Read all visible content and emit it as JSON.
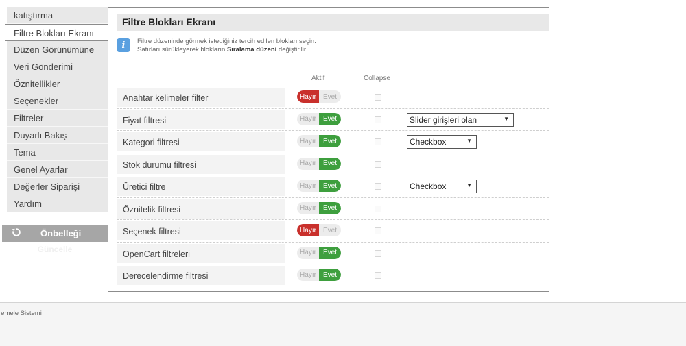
{
  "sidebar": {
    "items": [
      {
        "label": "katıştırma"
      },
      {
        "label": "Filtre Blokları Ekranı",
        "active": true
      },
      {
        "label": "Düzen Görünümüne"
      },
      {
        "label": "Veri Gönderimi"
      },
      {
        "label": "Öznitellikler"
      },
      {
        "label": "Seçenekler"
      },
      {
        "label": "Filtreler"
      },
      {
        "label": "Duyarlı Bakış"
      },
      {
        "label": "Tema"
      },
      {
        "label": "Genel Ayarlar"
      },
      {
        "label": "Değerler Siparişi"
      },
      {
        "label": "Yardım"
      }
    ],
    "cache_button": {
      "icon": "refresh-icon",
      "label": "Önbelleği",
      "sub_label": "Güncelle"
    }
  },
  "panel": {
    "title": "Filtre Blokları Ekranı",
    "info": {
      "icon": "info-icon",
      "line1": "Filtre düzeninde görmek istediğiniz tercih edilen blokları seçin.",
      "line2_prefix": "Satırları sürükleyerek blokların ",
      "line2_bold": "Sıralama düzeni",
      "line2_suffix": " değiştirilir"
    },
    "columns": {
      "active": "Aktif",
      "collapse": "Collapse"
    },
    "toggle_labels": {
      "no": "Hayır",
      "yes": "Evet"
    },
    "rows": [
      {
        "label": "Anahtar kelimeler filter",
        "active": false,
        "collapse": false,
        "select": null
      },
      {
        "label": "Fiyat filtresi",
        "active": true,
        "collapse": false,
        "select": "Slider girişleri olan"
      },
      {
        "label": "Kategori filtresi",
        "active": true,
        "collapse": false,
        "select": "Checkbox"
      },
      {
        "label": "Stok durumu filtresi",
        "active": true,
        "collapse": false,
        "select": null
      },
      {
        "label": "Üretici filtre",
        "active": true,
        "collapse": false,
        "select": "Checkbox"
      },
      {
        "label": "Öznitelik filtresi",
        "active": true,
        "collapse": false,
        "select": null
      },
      {
        "label": "Seçenek filtresi",
        "active": false,
        "collapse": false,
        "select": null
      },
      {
        "label": "OpenCart filtreleri",
        "active": true,
        "collapse": false,
        "select": null
      },
      {
        "label": "Derecelendirme filtresi",
        "active": true,
        "collapse": false,
        "select": null
      }
    ]
  },
  "footer": {
    "text": "remele Sistemi"
  },
  "colors": {
    "toggle_no": "#c9302c",
    "toggle_yes": "#3e9f3e",
    "info_icon": "#5aa0e0",
    "cache_button": "#a6a6a6"
  }
}
